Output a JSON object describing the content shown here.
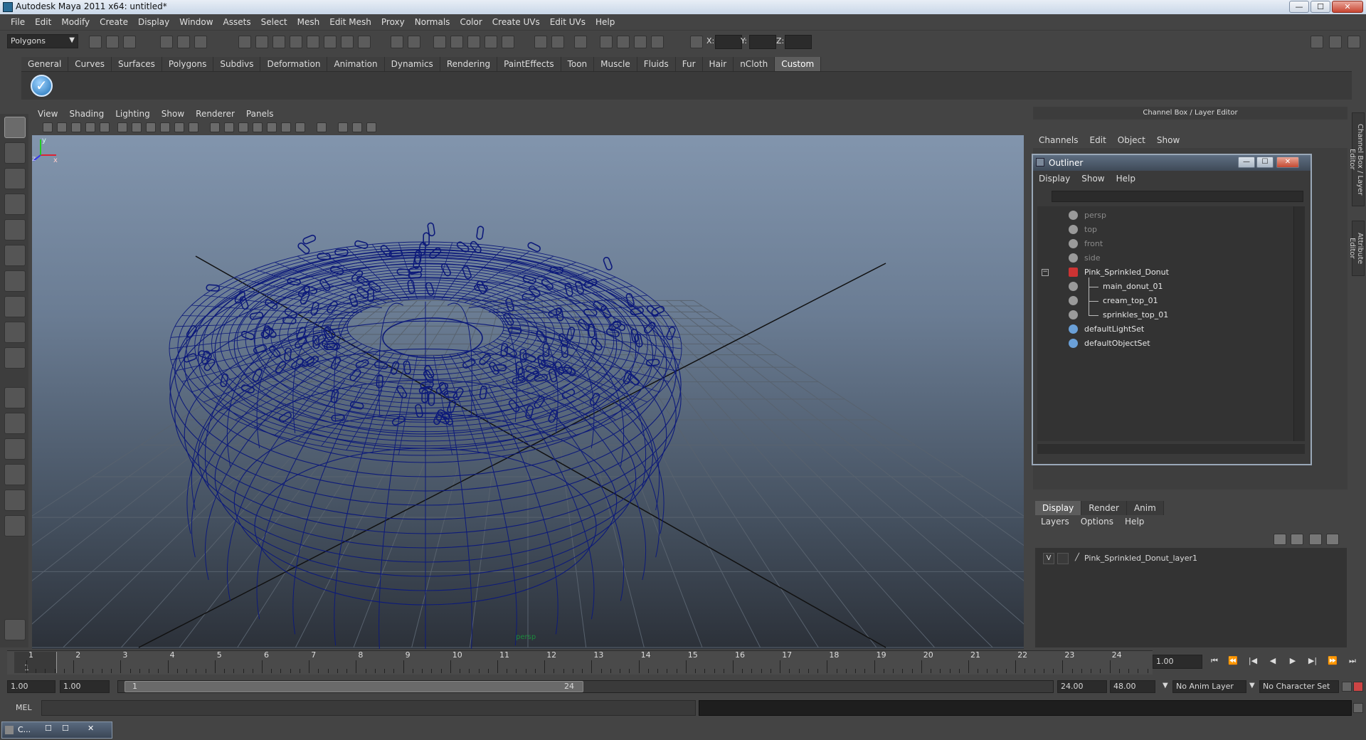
{
  "window": {
    "title": "Autodesk Maya 2011 x64: untitled*",
    "min": "—",
    "max": "☐",
    "close": "✕"
  },
  "menu": [
    "File",
    "Edit",
    "Modify",
    "Create",
    "Display",
    "Window",
    "Assets",
    "Select",
    "Mesh",
    "Edit Mesh",
    "Proxy",
    "Normals",
    "Color",
    "Create UVs",
    "Edit UVs",
    "Help"
  ],
  "status_line": {
    "mode": "Polygons",
    "x_label": "X:",
    "y_label": "Y:",
    "z_label": "Z:"
  },
  "shelf": {
    "tabs": [
      "General",
      "Curves",
      "Surfaces",
      "Polygons",
      "Subdivs",
      "Deformation",
      "Animation",
      "Dynamics",
      "Rendering",
      "PaintEffects",
      "Toon",
      "Muscle",
      "Fluids",
      "Fur",
      "Hair",
      "nCloth",
      "Custom"
    ],
    "active_tab": "Custom"
  },
  "viewport": {
    "menu": [
      "View",
      "Shading",
      "Lighting",
      "Show",
      "Renderer",
      "Panels"
    ],
    "camera": "persp",
    "axis": {
      "x": "x",
      "y": "y",
      "z": "z"
    },
    "wire_color": "#0d1a7a"
  },
  "channel_box": {
    "header": "Channel Box / Layer Editor",
    "menu": [
      "Channels",
      "Edit",
      "Object",
      "Show"
    ]
  },
  "outliner": {
    "title": "Outliner",
    "menu": [
      "Display",
      "Show",
      "Help"
    ],
    "items": [
      {
        "label": "persp",
        "dim": true
      },
      {
        "label": "top",
        "dim": true
      },
      {
        "label": "front",
        "dim": true
      },
      {
        "label": "side",
        "dim": true
      },
      {
        "label": "Pink_Sprinkled_Donut",
        "dim": false
      },
      {
        "label": "main_donut_01",
        "dim": false
      },
      {
        "label": "cream_top_01",
        "dim": false
      },
      {
        "label": "sprinkles_top_01",
        "dim": false
      },
      {
        "label": "defaultLightSet",
        "dim": false
      },
      {
        "label": "defaultObjectSet",
        "dim": false
      }
    ],
    "collapse_symbol": "−"
  },
  "layer_editor": {
    "tabs": [
      "Display",
      "Render",
      "Anim"
    ],
    "active_tab": "Display",
    "menu": [
      "Layers",
      "Options",
      "Help"
    ],
    "layer": {
      "visible": "V",
      "name": "Pink_Sprinkled_Donut_layer1"
    }
  },
  "side_tabs": [
    "Channel Box / Layer Editor",
    "Attribute Editor"
  ],
  "time_slider": {
    "ticks": [
      "1",
      "2",
      "3",
      "4",
      "5",
      "6",
      "7",
      "8",
      "9",
      "10",
      "11",
      "12",
      "13",
      "14",
      "15",
      "16",
      "17",
      "18",
      "19",
      "20",
      "21",
      "22",
      "23",
      "24"
    ],
    "current_frame_display": "1",
    "current_time": "1.00"
  },
  "range_slider": {
    "start_time": "1.00",
    "playback_start": "1.00",
    "handle_start": "1",
    "handle_end": "24",
    "playback_end": "24.00",
    "end_time": "48.00",
    "anim_layer": "No Anim Layer",
    "character_set": "No Character Set"
  },
  "command_line": {
    "label": "MEL"
  },
  "taskbar": {
    "item": "C..."
  }
}
